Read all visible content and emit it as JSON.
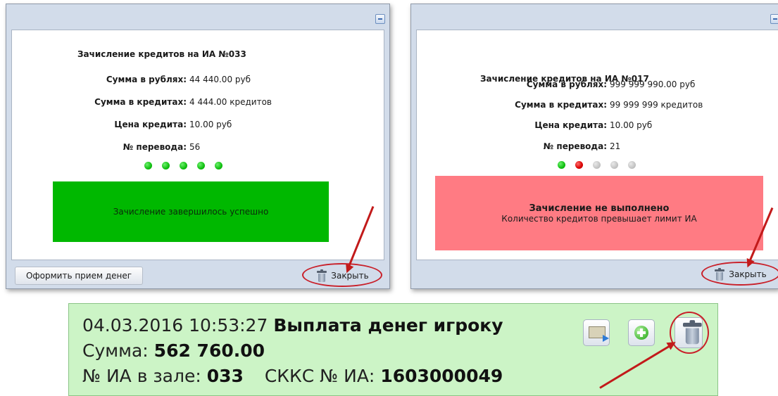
{
  "left_dialog": {
    "title": "Зачисление кредитов на ИА №033",
    "rows": [
      {
        "label": "Сумма в рублях:",
        "value": "44 440.00 руб"
      },
      {
        "label": "Сумма в кредитах:",
        "value": "4 444.00 кредитов"
      },
      {
        "label": "Цена кредита:",
        "value": "10.00 руб"
      },
      {
        "label": "№ перевода:",
        "value": "56"
      }
    ],
    "status_text": "Зачисление завершилось успешно",
    "receive_button": "Оформить прием денег",
    "close_button": "Закрыть"
  },
  "right_dialog": {
    "title": "Зачисление кредитов на ИА №017",
    "rows": [
      {
        "label": "Сумма в рублях:",
        "value": "999 999 990.00 руб"
      },
      {
        "label": "Сумма в кредитах:",
        "value": "99 999 999 кредитов"
      },
      {
        "label": "Цена кредита:",
        "value": "10.00 руб"
      },
      {
        "label": "№ перевода:",
        "value": "21"
      }
    ],
    "status_headline": "Зачисление не выполнено",
    "status_detail": "Количество кредитов превышает лимит ИА",
    "close_button": "Закрыть"
  },
  "payout_row": {
    "datetime": "04.03.2016 10:53:27",
    "event": "Выплата денег игроку",
    "sum_label": "Сумма:",
    "sum_value": "562 760.00",
    "ia_label": "№ ИА в зале:",
    "ia_value": "033",
    "skks_label": "СККС № ИА:",
    "skks_value": "1603000049"
  },
  "icons": {
    "minimize": "minimize-icon",
    "trash": "trash-icon",
    "money_transfer": "money-transfer-icon",
    "add": "add-icon"
  },
  "colors": {
    "success": "#00b800",
    "fail": "#ff7b83",
    "dot_green": "#0fbf0f",
    "dot_red": "#d90000",
    "dot_gray": "#c4c4c4",
    "highlight": "#c9202a",
    "strip_bg": "#ccf4c6"
  }
}
